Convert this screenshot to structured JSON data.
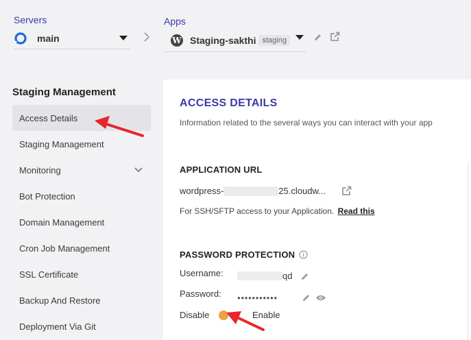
{
  "servers": {
    "label": "Servers",
    "selected": "main"
  },
  "apps": {
    "label": "Apps",
    "selected": "Staging-sakthi",
    "badge": "staging"
  },
  "sidebar": {
    "title": "Staging Management",
    "items": [
      {
        "label": "Access Details"
      },
      {
        "label": "Staging Management"
      },
      {
        "label": "Monitoring"
      },
      {
        "label": "Bot Protection"
      },
      {
        "label": "Domain Management"
      },
      {
        "label": "Cron Job Management"
      },
      {
        "label": "SSL Certificate"
      },
      {
        "label": "Backup And Restore"
      },
      {
        "label": "Deployment Via Git"
      }
    ]
  },
  "main": {
    "title": "ACCESS DETAILS",
    "description": "Information related to the several ways you can interact with your app",
    "app_url": {
      "heading": "APPLICATION URL",
      "url_prefix": "wordpress-",
      "url_suffix": "25.cloudw...",
      "ssh_note": "For SSH/SFTP access to your Application.",
      "read_this": "Read this"
    },
    "password_protection": {
      "heading": "PASSWORD PROTECTION",
      "username_label": "Username:",
      "username_suffix": "qd",
      "password_label": "Password:",
      "password_mask": "●●●●●●●●●●●",
      "disable_label": "Disable",
      "enable_label": "Enable"
    }
  },
  "colors": {
    "accent": "#3a3aa8",
    "annotation": "#e8262b",
    "toggle": "#f0a040"
  }
}
